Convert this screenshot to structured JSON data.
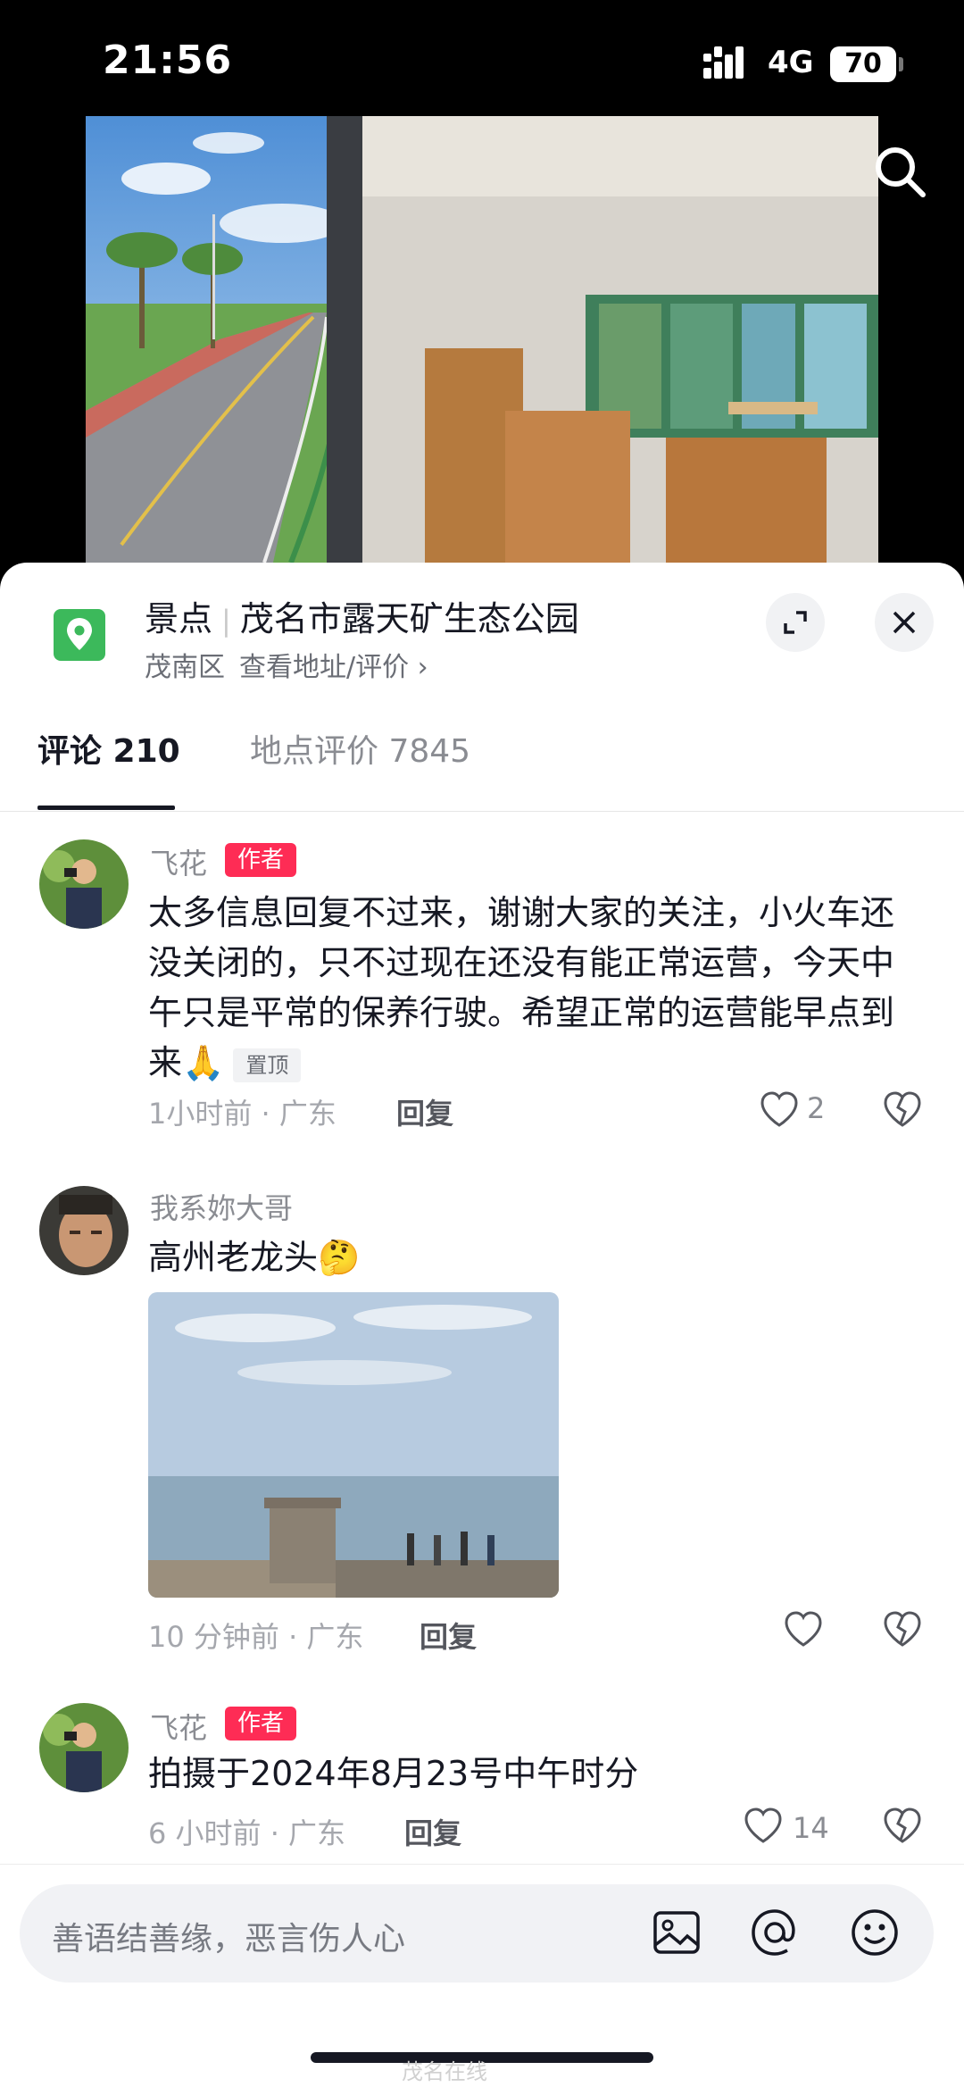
{
  "status_bar": {
    "time": "21:56",
    "network": "4G",
    "battery": "70"
  },
  "place": {
    "category": "景点",
    "name": "茂名市露天矿生态公园",
    "district": "茂南区",
    "link": "查看地址/评价 ›"
  },
  "tabs": [
    {
      "label": "评论 210",
      "active": true
    },
    {
      "label": "地点评价 7845",
      "active": false
    }
  ],
  "comments": [
    {
      "user": "飞花",
      "badge": "作者",
      "text": "太多信息回复不过来，谢谢大家的关注，小火车还没关闭的，只不过现在还没有能正常运营，今天中午只是平常的保养行驶。希望正常的运营能早点到来",
      "emoji": "🙏",
      "pinned": "置顶",
      "meta": "1小时前 · 广东",
      "reply": "回复",
      "likes": "2"
    },
    {
      "user": "我系妳大哥",
      "text": "高州老龙头",
      "emoji": "🤔",
      "meta": "10 分钟前 · 广东",
      "reply": "回复",
      "likes": ""
    },
    {
      "user": "飞花",
      "badge": "作者",
      "text": "拍摄于2024年8月23号中午时分",
      "meta": "6 小时前 · 广东",
      "reply": "回复",
      "likes": "14"
    }
  ],
  "input": {
    "placeholder": "善语结善缘，恶言伤人心"
  },
  "icons": [
    "signal-icon",
    "search-icon",
    "location-pin-icon",
    "expand-icon",
    "close-icon",
    "heart-icon",
    "broken-heart-icon",
    "image-icon",
    "at-icon",
    "emoji-icon"
  ],
  "colors": {
    "author_badge": "#fe2c55",
    "pin": "#3cb95b",
    "tab_underline": "#161823"
  },
  "watermark": "茂名在线"
}
